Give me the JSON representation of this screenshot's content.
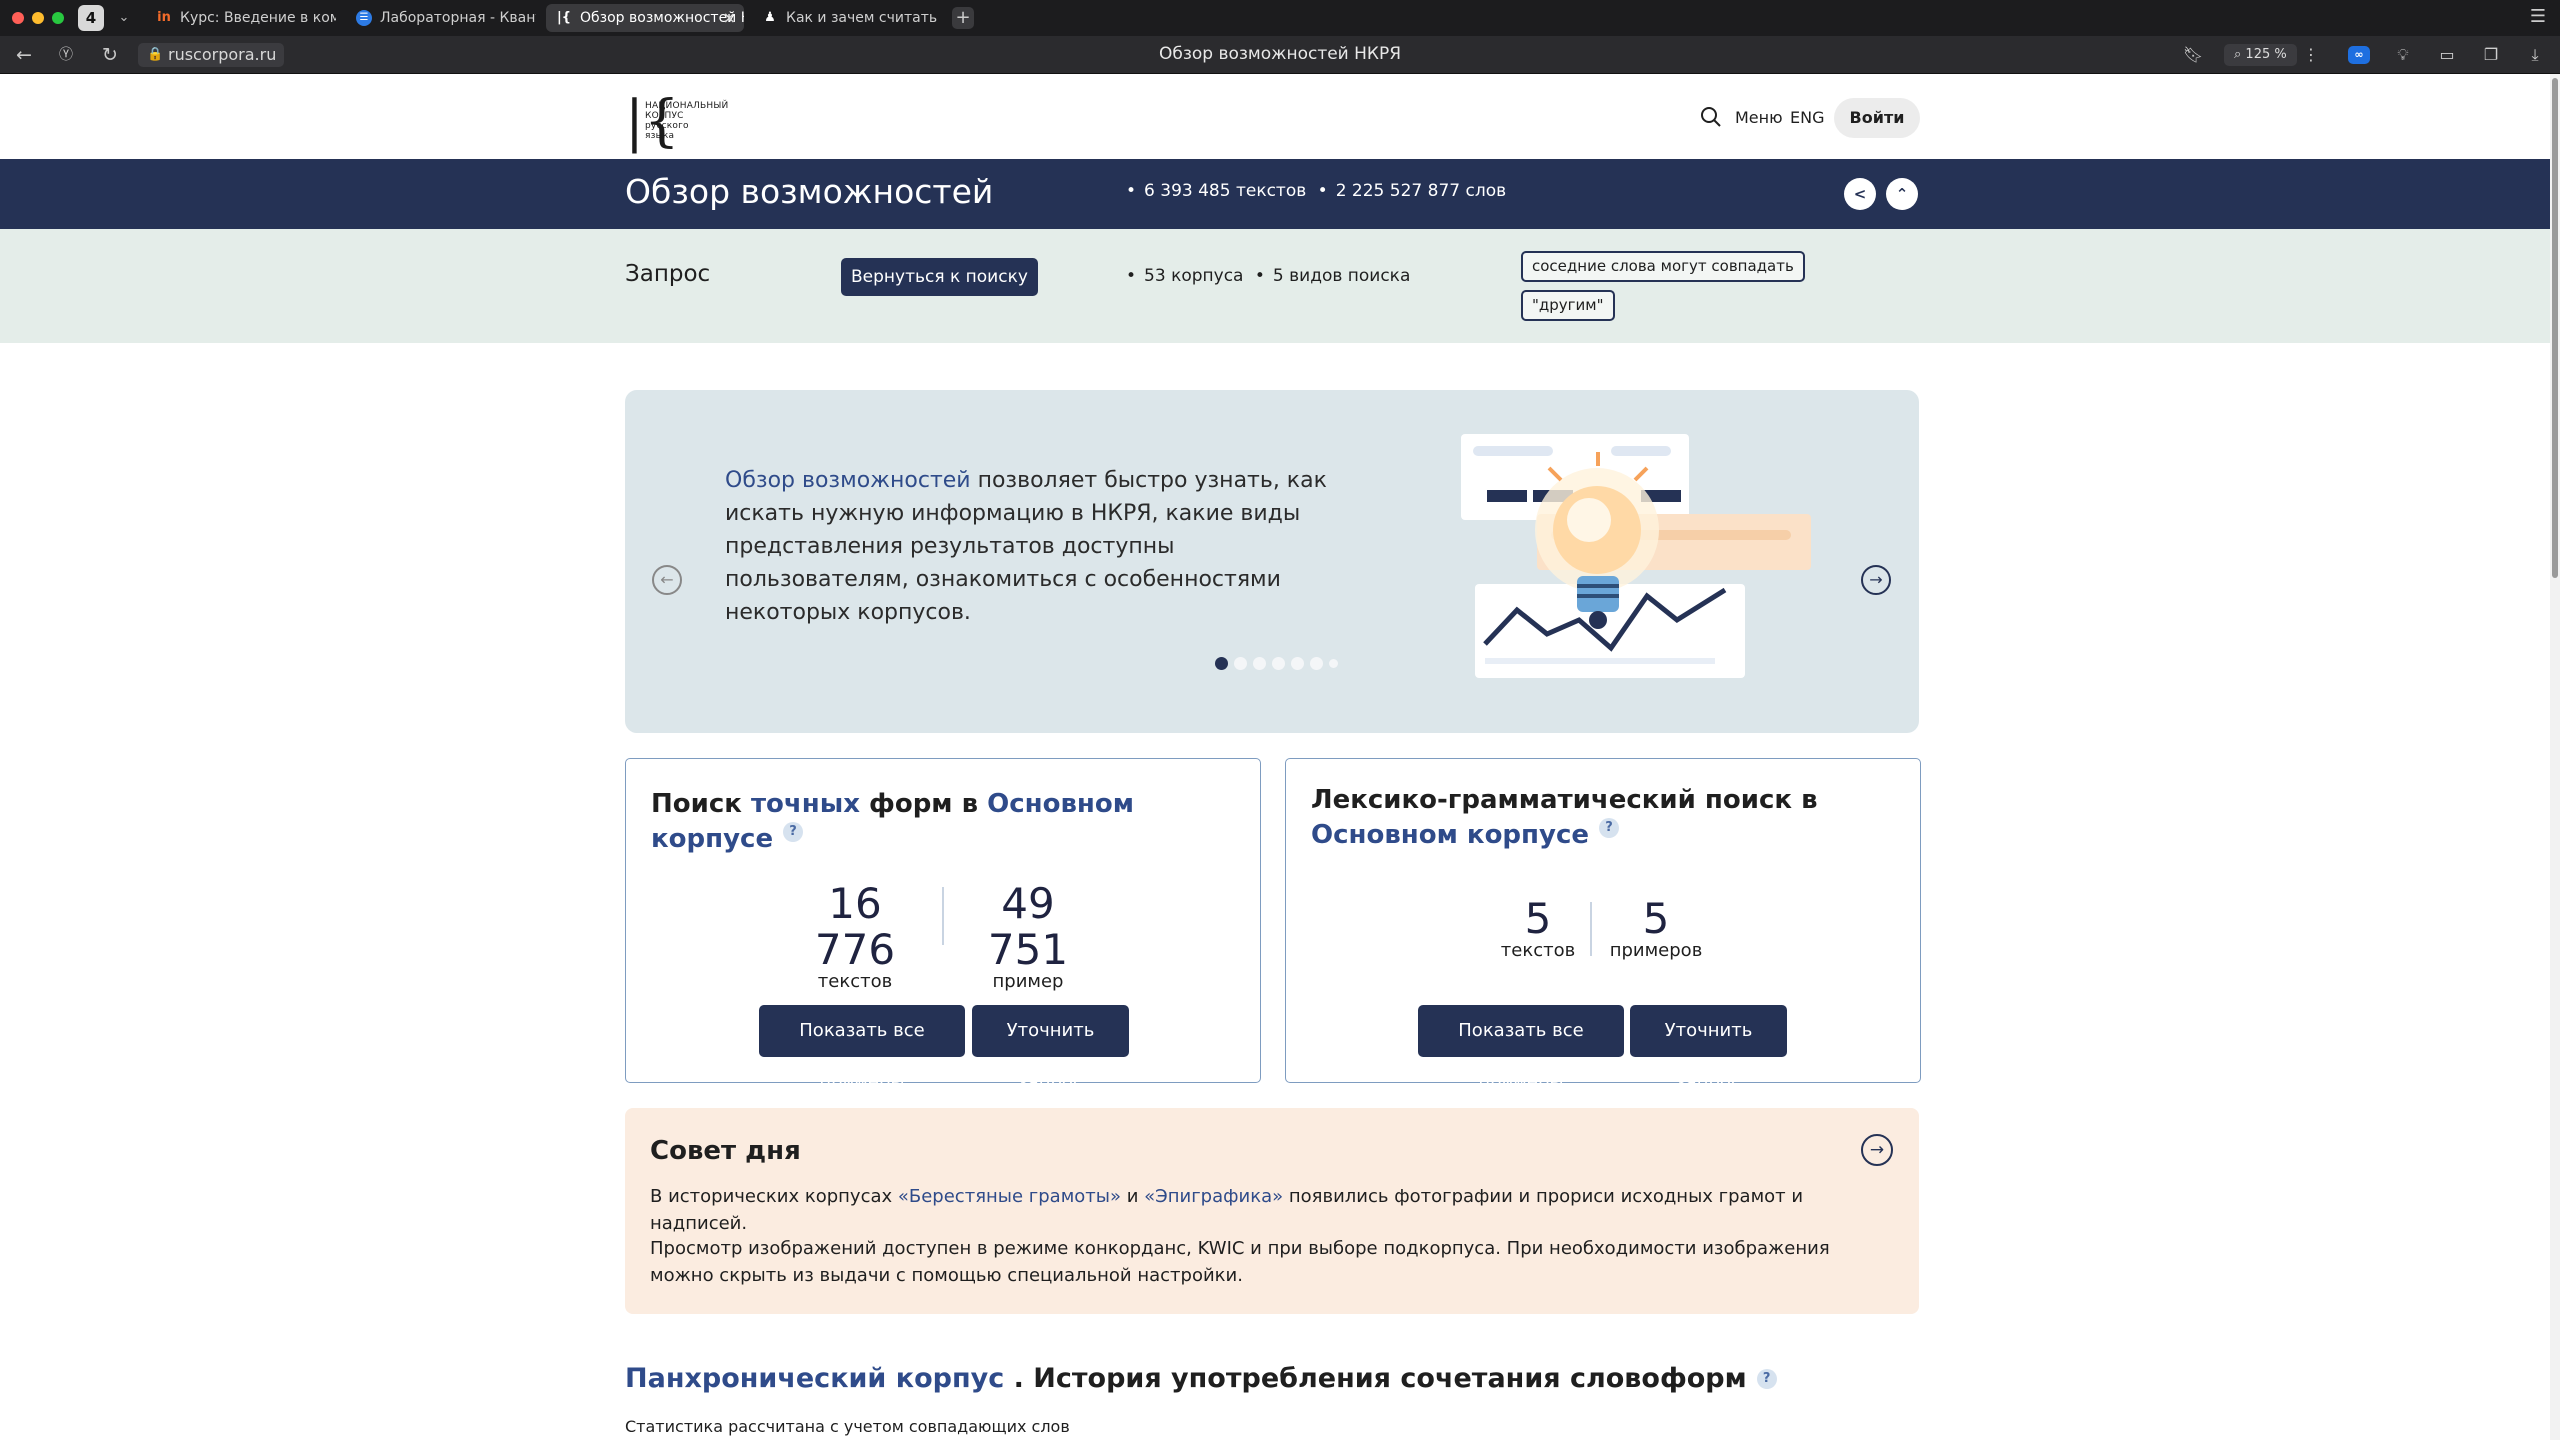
{
  "browser": {
    "tab_count": "4",
    "tabs": [
      {
        "label": "Курс: Введение в компьютерную лингвистику",
        "favicon": "in"
      },
      {
        "label": "Лабораторная - Квантитативная лингвистика",
        "favicon": "☰"
      },
      {
        "label": "Обзор возможностей НКРЯ",
        "favicon": "|{",
        "active": true
      },
      {
        "label": "Как и зачем считать частотность",
        "favicon": "♟"
      }
    ],
    "url": "ruscorpora.ru",
    "page_title": "Обзор возможностей НКРЯ",
    "zoom": "125 %",
    "ext_label": "∞"
  },
  "header": {
    "logo_lines": [
      "НАЦИОНАЛЬНЫЙ",
      "КОРПУС",
      "русского",
      "языка"
    ],
    "menu_label": "Меню",
    "lang_label": "ENG",
    "login_label": "Войти"
  },
  "hero": {
    "title": "Обзор возможностей",
    "texts_stat": "6 393 485 текстов",
    "words_stat": "2 225 527 877 слов"
  },
  "query": {
    "label": "Запрос",
    "back_button": "Вернуться к поиску",
    "corpora_stat": "53 корпуса",
    "search_types_stat": "5 видов поиска",
    "chip1": "соседние слова могут совпадать",
    "chip2": "\"другим\""
  },
  "carousel": {
    "link_text": "Обзор возможностей",
    "text": " позволяет быстро узнать, как искать нужную информацию в НКРЯ, какие виды представления результатов доступны пользователям, ознакомиться с особенностями некоторых корпусов.",
    "dot_count": 7,
    "active_dot": 0
  },
  "card_exact": {
    "title_a": "Поиск ",
    "title_hl1": "точных",
    "title_b": " форм в ",
    "title_hl2": "Основном корпусе",
    "help": "?",
    "texts_num": "16 776",
    "texts_lbl": "текстов",
    "examples_num": "49 751",
    "examples_lbl": "пример",
    "show_all": "Показать все примеры",
    "refine": "Уточнить запрос"
  },
  "card_lexgram": {
    "title_a": "Лексико-грамматический поиск в ",
    "title_hl": "Основном корпусе",
    "help": "?",
    "texts_num": "5",
    "texts_lbl": "текстов",
    "examples_num": "5",
    "examples_lbl": "примеров",
    "show_all": "Показать все примеры",
    "refine": "Уточнить запрос"
  },
  "tip": {
    "title": "Совет дня",
    "p1_a": "В исторических корпусах ",
    "p1_link1": "«Берестяные грамоты»",
    "p1_b": " и ",
    "p1_link2": "«Эпиграфика»",
    "p1_c": " появились фотографии и прориси исходных грамот и надписей.",
    "p2": "Просмотр изображений доступен в режиме конкорданс, KWIC и при выборе подкорпуса. При необходимости изображения можно скрыть из выдачи с помощью специальной настройки."
  },
  "panchronic": {
    "title_hl": "Панхронический корпус",
    "title_rest": " . История употребления сочетания словоформ",
    "help": "?",
    "subtitle": "Статистика рассчитана с учетом совпадающих слов"
  },
  "colors": {
    "navy": "#253255",
    "link": "#2f4b8a",
    "query_bg": "#e4ede9",
    "carousel_bg": "#dce6ea",
    "tip_bg": "#fbece0"
  }
}
